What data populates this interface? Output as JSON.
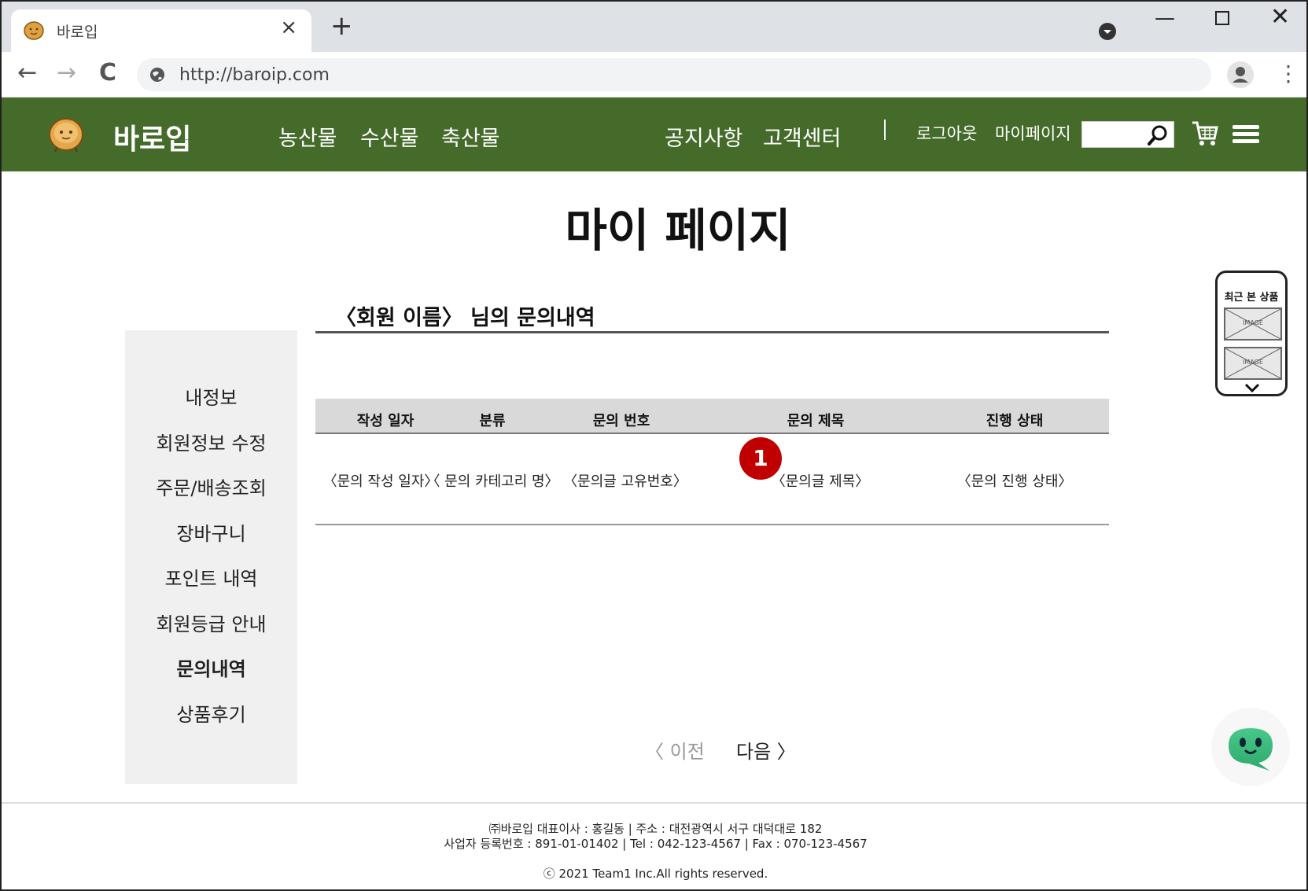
{
  "browser": {
    "tab_title": "바로입",
    "tab_close": "×",
    "new_tab": "+",
    "url": "http://baroip.com",
    "back": "←",
    "forward": "→",
    "reload": "C",
    "window_min": "—",
    "window_close": "✕",
    "menu": "⋮"
  },
  "header": {
    "logo_text": "바로입",
    "nav": [
      "농산물",
      "수산물",
      "축산물"
    ],
    "nav_right": [
      "공지사항",
      "고객센터"
    ],
    "logout": "로그아웃",
    "mypage": "마이페이지",
    "search_value": "",
    "brand_color": "#456b2b"
  },
  "page": {
    "title": "마이 페이지",
    "section_title": "〈회원 이름〉 님의 문의내역"
  },
  "sidebar": {
    "items": [
      {
        "label": "내정보"
      },
      {
        "label": "회원정보 수정"
      },
      {
        "label": "주문/배송조회"
      },
      {
        "label": "장바구니"
      },
      {
        "label": "포인트 내역"
      },
      {
        "label": "회원등급 안내"
      },
      {
        "label": "문의내역"
      },
      {
        "label": "상품후기"
      }
    ],
    "active": "문의내역"
  },
  "table": {
    "columns": [
      "작성 일자",
      "분류",
      "문의 번호",
      "문의 제목",
      "진행 상태"
    ],
    "rows": [
      [
        "〈문의 작성 일자〉",
        "〈 문의 카테고리 명〉",
        "〈문의글 고유번호〉",
        "〈문의글 제목〉",
        "〈문의 진행 상태〉"
      ]
    ]
  },
  "annotation": {
    "badge": "1",
    "badge_color": "#c00000"
  },
  "pager": {
    "prev": "〈 이전",
    "next": "다음 〉"
  },
  "recent": {
    "title": "최근 본 상품",
    "image_label": "IMAGE"
  },
  "footer": {
    "line1": "㈜바로입 대표이사 : 홍길동 | 주소 : 대전광역시 서구 대덕대로 182",
    "line2": "사업자 등록번호 : 891-01-01402 | Tel : 042-123-4567 | Fax : 070-123-4567",
    "copyright": "ⓒ 2021 Team1 Inc.All rights reserved."
  }
}
